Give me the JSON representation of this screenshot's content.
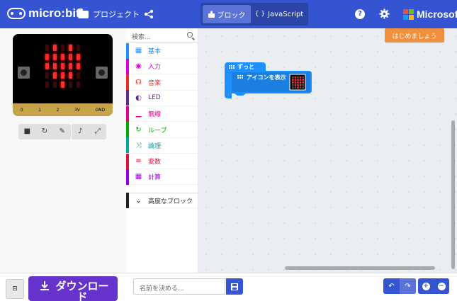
{
  "header": {
    "logo_text": "micro:bit",
    "projects_label": "プロジェクト",
    "blocks_tab": "ブロック",
    "js_tab": "JavaScript",
    "js_tab_icon": "{ }",
    "help_glyph": "?",
    "brand": "Microsoft",
    "brand_colors": [
      "#f25022",
      "#7fba00",
      "#00a4ef",
      "#ffb900"
    ]
  },
  "simulator": {
    "pins": [
      "0",
      "1",
      "2",
      "3V",
      "GND"
    ],
    "led_on_color": "#ff2a2a",
    "led_off_color": "#3a0a0a",
    "led_matrix": [
      [
        0,
        1,
        0,
        1,
        0
      ],
      [
        1,
        1,
        1,
        1,
        1
      ],
      [
        1,
        1,
        1,
        1,
        1
      ],
      [
        0,
        1,
        1,
        1,
        0
      ],
      [
        0,
        0,
        1,
        0,
        0
      ]
    ]
  },
  "toolbox": {
    "search_placeholder": "検索...",
    "categories": [
      {
        "label": "基本",
        "color": "#1e90ff",
        "icon": "grid-icon"
      },
      {
        "label": "入力",
        "color": "#d400d4",
        "icon": "circle-dot-icon"
      },
      {
        "label": "音楽",
        "color": "#e63022",
        "icon": "headphones-icon"
      },
      {
        "label": "LED",
        "color": "#5c2d91",
        "icon": "toggle-icon"
      },
      {
        "label": "無線",
        "color": "#e3008c",
        "icon": "signal-icon"
      },
      {
        "label": "ループ",
        "color": "#00aa00",
        "icon": "loop-icon"
      },
      {
        "label": "論理",
        "color": "#00a4a6",
        "icon": "shuffle-icon"
      },
      {
        "label": "変数",
        "color": "#dc143c",
        "icon": "lines-icon"
      },
      {
        "label": "計算",
        "color": "#9400d3",
        "icon": "calculator-icon"
      }
    ],
    "advanced_label": "高度なブロック"
  },
  "workspace": {
    "start_button": "はじめましょう",
    "forever_label": "ずっと",
    "show_icon_label": "アイコンを表示",
    "block_color": "#1e90ff"
  },
  "bottom": {
    "download_label": "ダウンロード",
    "name_placeholder": "名前を決める...",
    "undo": "↶",
    "redo": "↷",
    "zoom_in": "+",
    "zoom_out": "−"
  }
}
